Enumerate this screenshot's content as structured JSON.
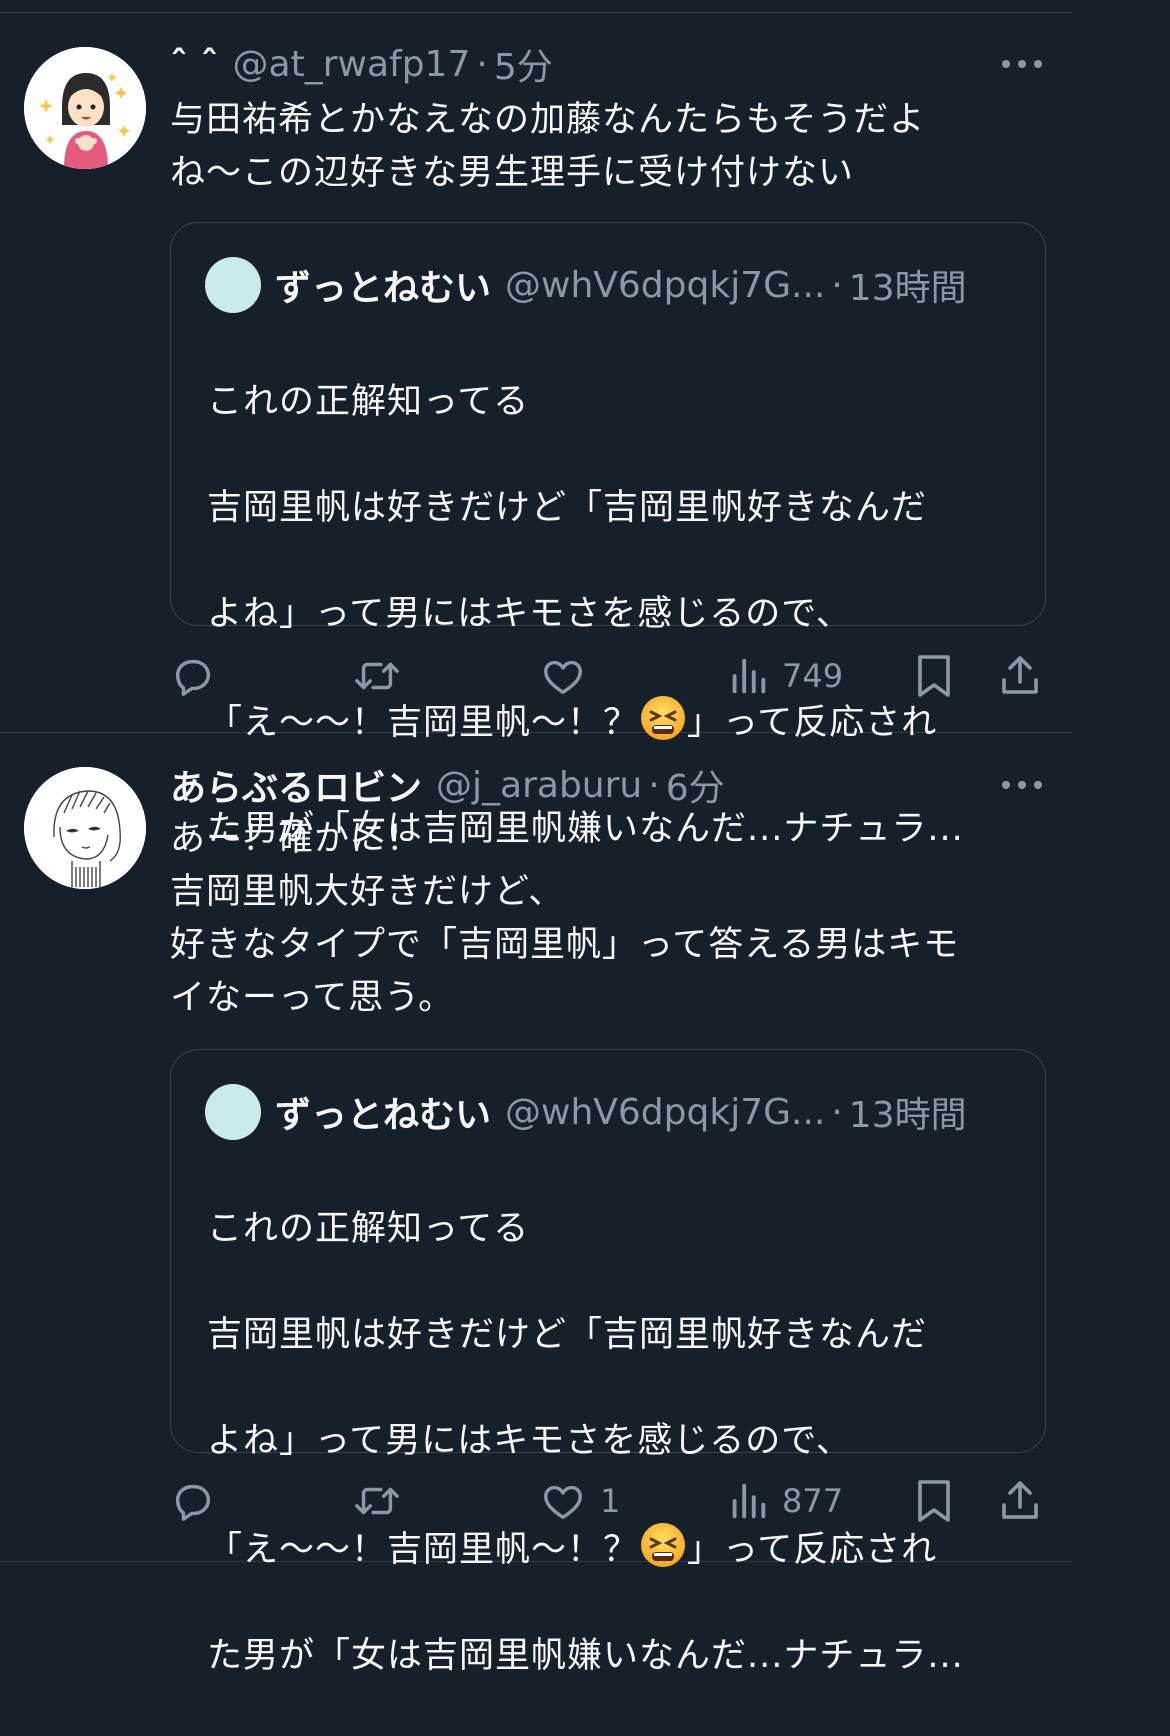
{
  "tweets": [
    {
      "name": "ˆ ˆ",
      "handle": "@at_rwafp17",
      "time": "5分",
      "text": "与田祐希とかなえなの加藤なんたらもそうだよ\nね〜この辺好きな男生理手に受け付けない",
      "quote": {
        "name": "ずっとねむい",
        "handle": "@whV6dpqkj7G...",
        "time": "13時間",
        "line1": "これの正解知ってる",
        "line2": "吉岡里帆は好きだけど「吉岡里帆好きなんだ",
        "line3": "よね」って男にはキモさを感じるので、",
        "line4a": "「え〜〜！吉岡里帆〜！？",
        "line4b": "」って反応され",
        "line5": "た男が「女は吉岡里帆嫌いなんだ...ナチュラ..."
      },
      "views": "749",
      "likes": ""
    },
    {
      "name": "あらぶるロビン",
      "handle": "@j_araburu",
      "time": "6分",
      "text": "あー！確かに！\n吉岡里帆大好きだけど、\n好きなタイプで「吉岡里帆」って答える男はキモ\nイなーって思う。",
      "quote": {
        "name": "ずっとねむい",
        "handle": "@whV6dpqkj7G...",
        "time": "13時間",
        "line1": "これの正解知ってる",
        "line2": "吉岡里帆は好きだけど「吉岡里帆好きなんだ",
        "line3": "よね」って男にはキモさを感じるので、",
        "line4a": "「え〜〜！吉岡里帆〜！？",
        "line4b": "」って反応され",
        "line5": "た男が「女は吉岡里帆嫌いなんだ...ナチュラ..."
      },
      "views": "877",
      "likes": "1"
    }
  ],
  "dot_separator": "·",
  "colors": {
    "background": "#15202b",
    "text": "#f7f9f9",
    "muted": "#8b98a5",
    "border": "#38444d"
  },
  "icons": [
    "reply-icon",
    "retweet-icon",
    "like-icon",
    "views-icon",
    "bookmark-icon",
    "share-icon",
    "more-icon",
    "tired-face-emoji"
  ]
}
